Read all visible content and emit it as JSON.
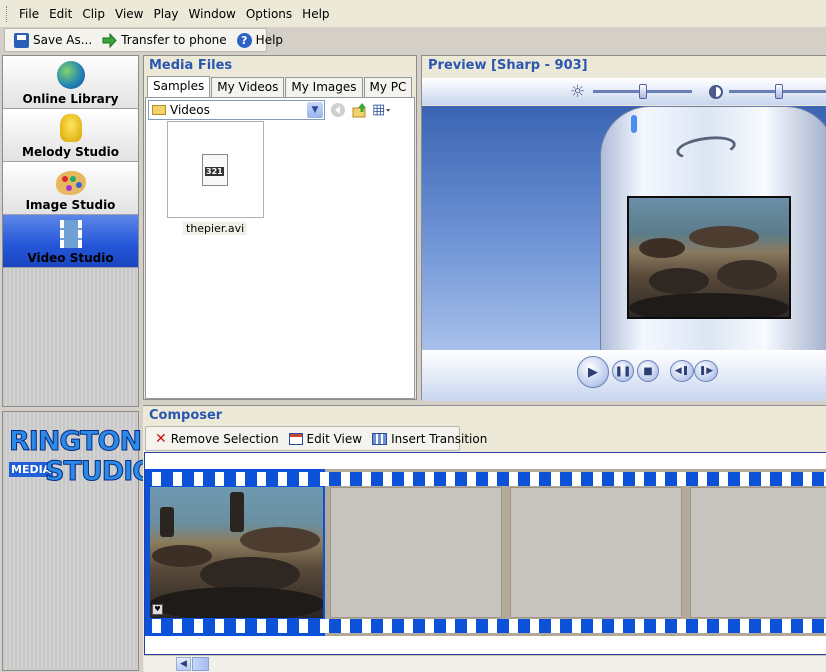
{
  "menu": [
    "File",
    "Edit",
    "Clip",
    "View",
    "Play",
    "Window",
    "Options",
    "Help"
  ],
  "toolbar": {
    "save_label": "Save As...",
    "transfer_label": "Transfer to phone",
    "help_label": "Help"
  },
  "nav": {
    "items": [
      {
        "label": "Online Library",
        "icon": "globe-icon"
      },
      {
        "label": "Melody Studio",
        "icon": "bell-icon"
      },
      {
        "label": "Image Studio",
        "icon": "palette-icon"
      },
      {
        "label": "Video Studio",
        "icon": "film-icon",
        "active": true
      }
    ]
  },
  "logo": {
    "line1": "RINGTONE",
    "media": "MEDIA",
    "line2": "STUDIO"
  },
  "media": {
    "title": "Media Files",
    "tabs": [
      "Samples",
      "My Videos",
      "My Images",
      "My PC"
    ],
    "active_tab": "Samples",
    "folder": "Videos",
    "files": [
      {
        "name": "thepier.avi",
        "icon": "video-file-icon"
      }
    ]
  },
  "preview": {
    "title": "Preview [Sharp - 903]",
    "icons": [
      "brightness-icon",
      "contrast-icon"
    ],
    "controls": [
      "play-button",
      "pause-button",
      "stop-button",
      "rewind-button",
      "fast-forward-button"
    ]
  },
  "composer": {
    "title": "Composer",
    "remove_label": "Remove Selection",
    "edit_label": "Edit View",
    "insert_label": "Insert Transition"
  },
  "colors": {
    "accent": "#2b56b0",
    "nav_active": "#2356d8",
    "clip_border": "#0b52d8",
    "logo_blue": "#2a8ae8"
  }
}
